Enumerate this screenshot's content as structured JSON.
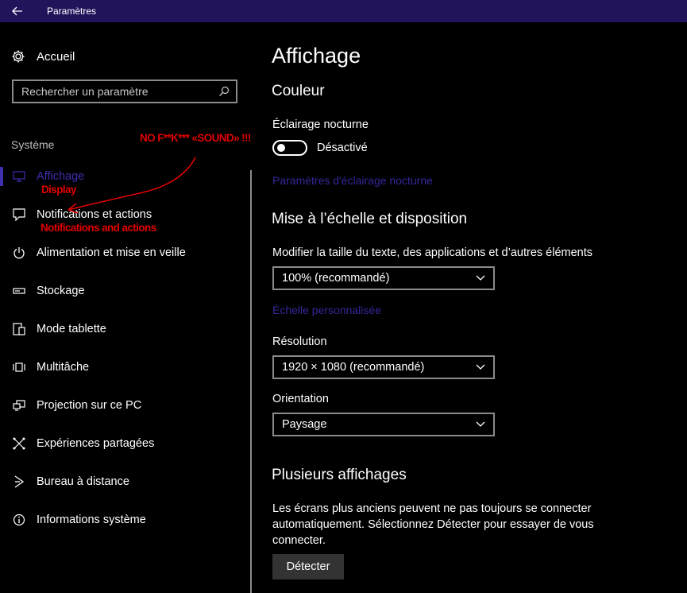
{
  "window": {
    "title": "Paramètres"
  },
  "sidebar": {
    "home_label": "Accueil",
    "search_placeholder": "Rechercher un paramètre",
    "section_label": "Système",
    "items": [
      {
        "label": "Affichage",
        "icon": "monitor-icon",
        "selected": true
      },
      {
        "label": "Notifications et actions",
        "icon": "notification-icon"
      },
      {
        "label": "Alimentation et mise en veille",
        "icon": "power-icon"
      },
      {
        "label": "Stockage",
        "icon": "storage-icon"
      },
      {
        "label": "Mode tablette",
        "icon": "tablet-icon"
      },
      {
        "label": "Multitâche",
        "icon": "multitask-icon"
      },
      {
        "label": "Projection sur ce PC",
        "icon": "projection-icon"
      },
      {
        "label": "Expériences partagées",
        "icon": "share-icon"
      },
      {
        "label": "Bureau à distance",
        "icon": "remote-desktop-icon"
      },
      {
        "label": "Informations système",
        "icon": "info-icon"
      }
    ]
  },
  "annotations": {
    "top": "NO F**K*** «SOUND» !!!",
    "display": "Display",
    "notifications": "Notifications and actions",
    "color": "#e00000"
  },
  "main": {
    "title": "Affichage",
    "color_section": {
      "heading": "Couleur",
      "night_light_label": "Éclairage nocturne",
      "toggle_state": "Désactivé",
      "night_light_link": "Paramètres d'éclairage nocturne"
    },
    "scale_section": {
      "heading": "Mise à l’échelle et disposition",
      "size_label": "Modifier la taille du texte, des applications et d’autres éléments",
      "size_value": "100% (recommandé)",
      "custom_link": "Échelle personnalisée",
      "resolution_label": "Résolution",
      "resolution_value": "1920 × 1080 (recommandé)",
      "orientation_label": "Orientation",
      "orientation_value": "Paysage"
    },
    "multi_section": {
      "heading": "Plusieurs affichages",
      "description": "Les écrans plus anciens peuvent ne pas toujours se connecter automatiquement. Sélectionnez Détecter pour essayer de vous connecter.",
      "detect_button": "Détecter"
    }
  },
  "colors": {
    "titlebar": "#22135a",
    "accent": "#3d2fb0",
    "link": "#33289a"
  }
}
